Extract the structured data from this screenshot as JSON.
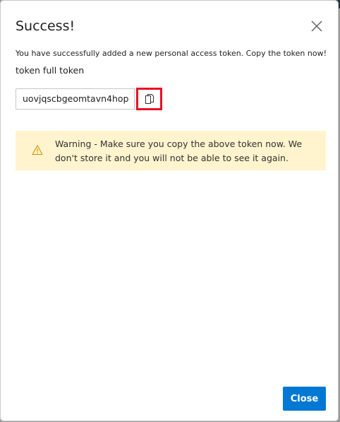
{
  "dialog": {
    "title": "Success!",
    "message": "You have successfully added a new personal access token. Copy the token now!",
    "token_label": "token full token",
    "token_value": "uovjqscbgeomtavn4hop",
    "warning_text": "Warning - Make sure you copy the above token now. We don't store it and you will not be able to see it again.",
    "close_label": "Close"
  },
  "icons": {
    "close": "close-icon",
    "copy": "copy-icon",
    "warning": "warning-icon"
  },
  "colors": {
    "primary": "#0078d4",
    "warning_bg": "#fff4ce",
    "warning_icon": "#d39300",
    "highlight": "#e81123"
  }
}
